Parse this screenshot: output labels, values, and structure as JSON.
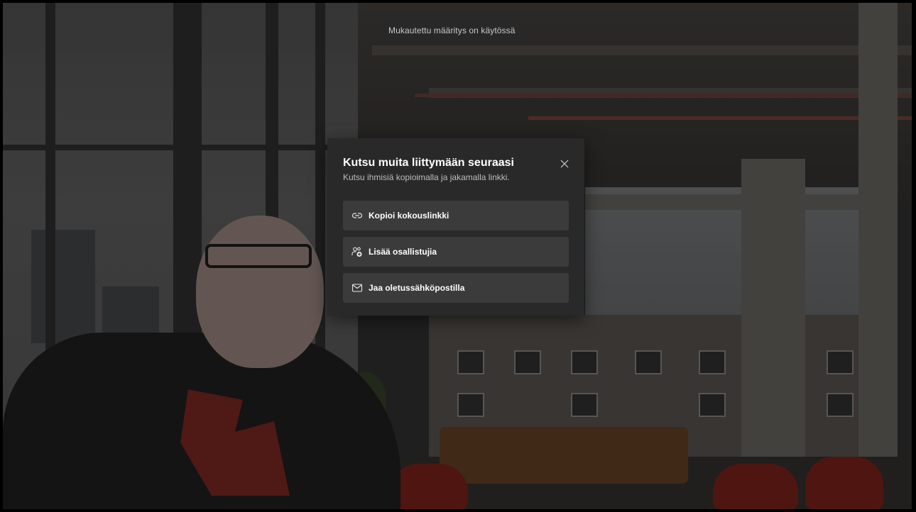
{
  "banner": {
    "text": "Mukautettu määritys on käytössä"
  },
  "dialog": {
    "title": "Kutsu muita liittymään seuraasi",
    "subtitle": "Kutsu ihmisiä kopioimalla ja jakamalla linkki.",
    "close_icon": "close-icon",
    "actions": [
      {
        "label": "Kopioi kokouslinkki",
        "icon": "link-icon"
      },
      {
        "label": "Lisää osallistujia",
        "icon": "add-people-icon"
      },
      {
        "label": "Jaa oletussähköpostilla",
        "icon": "mail-icon"
      }
    ]
  },
  "colors": {
    "dialog_bg": "#292929",
    "button_bg": "#3b3b3b",
    "text_primary": "#ffffff",
    "text_secondary": "#bdbdbd"
  }
}
